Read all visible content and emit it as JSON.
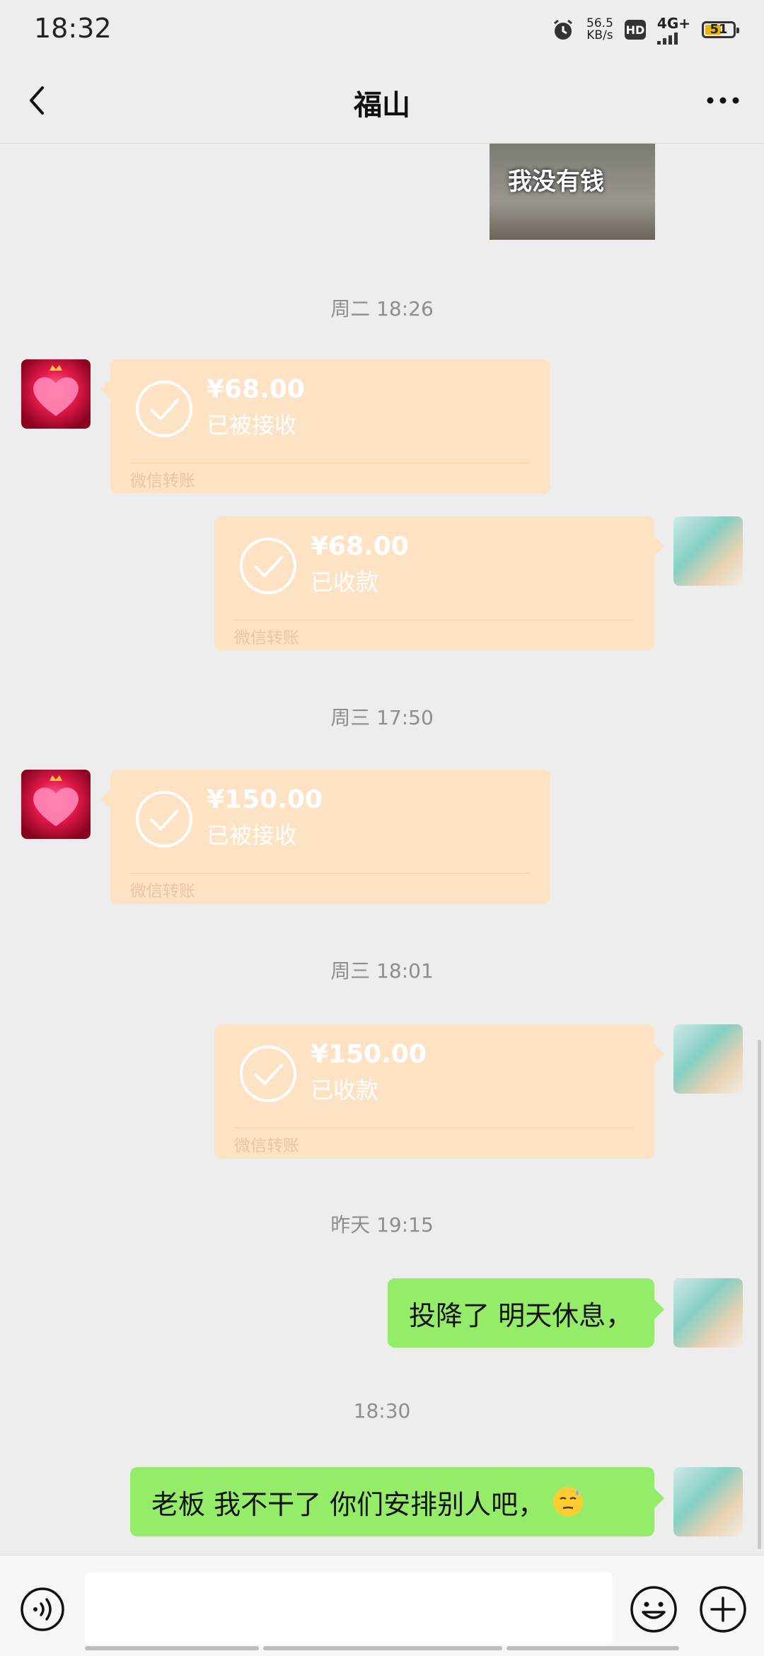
{
  "status_bar": {
    "time": "18:32",
    "net_speed_value": "56.5",
    "net_speed_unit": "KB/s",
    "hd_label": "HD",
    "network_label": "4G+",
    "battery_level": "51"
  },
  "header": {
    "title": "福山"
  },
  "sticker": {
    "caption": "我没有钱"
  },
  "timestamps": [
    "周二 18:26",
    "周三 17:50",
    "周三 18:01",
    "昨天 19:15",
    "18:30"
  ],
  "transfers": [
    {
      "amount": "¥68.00",
      "status": "已被接收",
      "footer": "微信转账"
    },
    {
      "amount": "¥68.00",
      "status": "已收款",
      "footer": "微信转账"
    },
    {
      "amount": "¥150.00",
      "status": "已被接收",
      "footer": "微信转账"
    },
    {
      "amount": "¥150.00",
      "status": "已收款",
      "footer": "微信转账"
    }
  ],
  "messages": [
    {
      "text": "投降了 明天休息，"
    },
    {
      "text": "老板 我不干了 你们安排别人吧，"
    }
  ],
  "colors": {
    "transfer_bg": "#fde2c4",
    "bubble_green": "#95ec69",
    "background": "#ededed"
  },
  "icons": {
    "back": "chevron-left-icon",
    "more": "more-dots-icon",
    "voice": "voice-icon",
    "emoji": "emoji-icon",
    "plus": "plus-icon",
    "check": "check-circle-icon"
  }
}
